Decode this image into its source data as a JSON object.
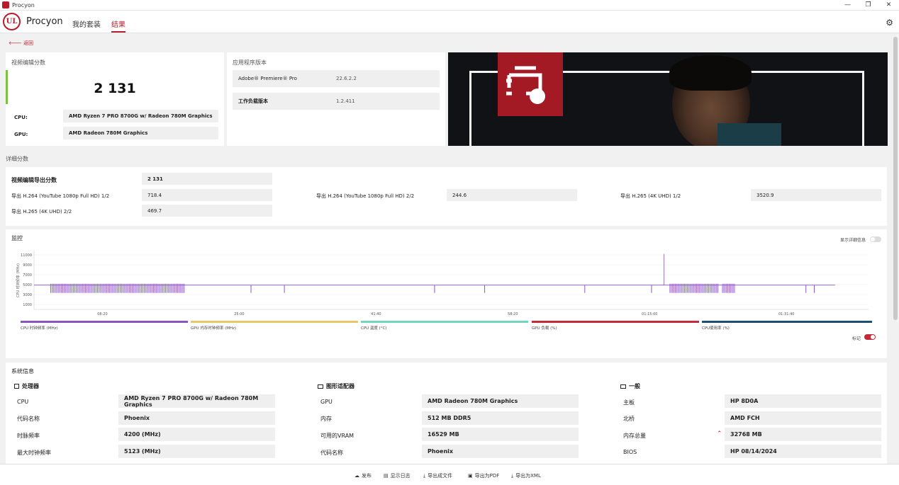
{
  "window": {
    "title": "Procyon",
    "controls": [
      "—",
      "❐",
      "✕"
    ]
  },
  "header": {
    "logo": "UL",
    "brand": "Procyon",
    "nav": [
      "我的套装",
      "结果"
    ],
    "active_nav": "结果"
  },
  "back_label": "返回",
  "score_card": {
    "title": "视频编辑分数",
    "score": "2 131",
    "cpu_label": "CPU:",
    "cpu_value": "AMD Ryzen 7 PRO 8700G w/ Radeon 780M Graphics",
    "gpu_label": "GPU:",
    "gpu_value": "AMD Radeon 780M Graphics"
  },
  "app_version": {
    "title": "应用程序版本",
    "rows": [
      {
        "label": "Adobe® Premiere® Pro",
        "value": "22.6.2.2"
      },
      {
        "label": "工作负载版本",
        "value": "1.2.411"
      }
    ]
  },
  "details": {
    "title": "详细分数",
    "main_label": "视频编辑导出分数",
    "main_value": "2 131",
    "items": [
      {
        "label": "导出 H.264 (YouTube 1080p Full HD) 1/2",
        "value": "718.4"
      },
      {
        "label": "导出 H.264 (YouTube 1080p Full HD) 2/2",
        "value": "244.6"
      },
      {
        "label": "导出 H.265 (4K UHD) 1/2",
        "value": "3520.9"
      },
      {
        "label": "导出 H.265 (4K UHD) 2/2",
        "value": "469.7"
      }
    ]
  },
  "monitor": {
    "title": "监控",
    "detail_toggle_label": "显示详细信息",
    "marker_label": "标记",
    "accent_color": "#c62a3a"
  },
  "chart_data": {
    "type": "line",
    "ylabel": "CPU 时钟频率 (MHz)",
    "yticks": [
      11000,
      9000,
      7000,
      5000,
      3000,
      1000
    ],
    "ylim": [
      0,
      12000
    ],
    "xticks": [
      "08:20",
      "25:00",
      "41:40",
      "58:20",
      "01:15:00",
      "01:31:40"
    ],
    "series": [
      {
        "name": "CPU 时钟频率 (MHz)",
        "color": "#8a54c4",
        "baseline": 4900,
        "spikes": [
          {
            "t": 0.755,
            "v": 11200
          }
        ]
      },
      {
        "name": "GPU 内存时钟频率 (MHz)",
        "color": "#e8c66a"
      },
      {
        "name": "CPU 温度 (°C)",
        "color": "#6fd7c0"
      },
      {
        "name": "GPU 负载 (%)",
        "color": "#c62a3a"
      },
      {
        "name": "CPU使用率 (%)",
        "color": "#1d4f73"
      }
    ],
    "burst_ranges": [
      [
        0.02,
        0.18
      ],
      [
        0.762,
        0.82
      ],
      [
        0.825,
        0.84
      ]
    ],
    "dips": [
      0.26,
      0.3,
      0.48,
      0.74,
      0.54,
      0.66,
      0.925,
      0.935
    ]
  },
  "system": {
    "title": "系统信息",
    "groups": [
      {
        "title": "处理器",
        "icon": "cpu-icon",
        "rows": [
          {
            "label": "CPU",
            "value": "AMD Ryzen 7 PRO 8700G w/ Radeon 780M Graphics"
          },
          {
            "label": "代码名称",
            "value": "Phoenix"
          },
          {
            "label": "时脉频率",
            "value": "4200 (MHz)"
          },
          {
            "label": "最大时钟频率",
            "value": "5123 (MHz)"
          }
        ]
      },
      {
        "title": "图形适配器",
        "icon": "gpu-icon",
        "rows": [
          {
            "label": "GPU",
            "value": "AMD Radeon 780M Graphics"
          },
          {
            "label": "内存",
            "value": "512 MB DDR5"
          },
          {
            "label": "可用的VRAM",
            "value": "16529 MB"
          },
          {
            "label": "代码名称",
            "value": "Phoenix"
          }
        ]
      },
      {
        "title": "一般",
        "icon": "monitor-icon",
        "rows": [
          {
            "label": "主板",
            "value": "HP 8D0A"
          },
          {
            "label": "北桥",
            "value": "AMD FCH"
          },
          {
            "label": "内存总量",
            "value": "32768 MB"
          },
          {
            "label": "BIOS",
            "value": "HP 08/14/2024"
          }
        ]
      }
    ]
  },
  "footer": {
    "buttons": [
      "发布",
      "显示日志",
      "导出成文件",
      "导出为PDF",
      "导出为XML"
    ]
  }
}
